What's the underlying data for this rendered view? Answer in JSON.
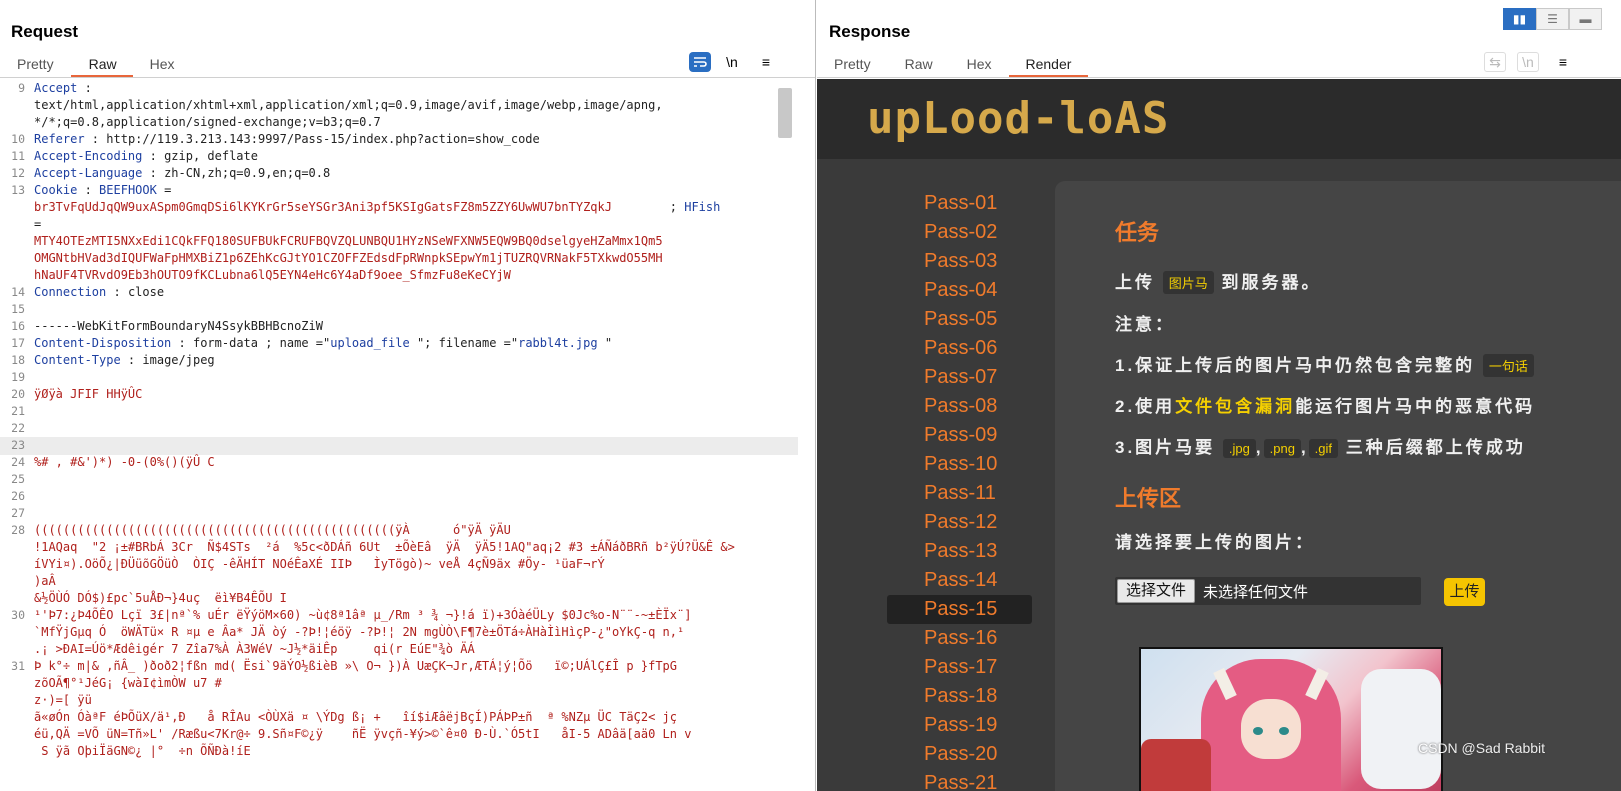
{
  "request": {
    "title": "Request",
    "tabs": [
      "Pretty",
      "Raw",
      "Hex"
    ],
    "active_tab": "Raw",
    "tools": {
      "wrap_icon": "wrap-icon",
      "newline": "\\n",
      "menu_icon": "menu-icon"
    },
    "lines": [
      {
        "n": "9",
        "k": "Accept",
        "sep": " :",
        "v": ""
      },
      {
        "n": "",
        "plain": "text/html,application/xhtml+xml,application/xml;q=0.9,image/avif,image/webp,image/apng,"
      },
      {
        "n": "",
        "plain": "*/*;q=0.8,application/signed-exchange;v=b3;q=0.7"
      },
      {
        "n": "10",
        "k": "Referer",
        "sep": " : ",
        "v": "http://119.3.213.143:9997/Pass-15/index.php?action=show_code"
      },
      {
        "n": "11",
        "k": "Accept-Encoding",
        "sep": " : ",
        "v": "gzip, deflate"
      },
      {
        "n": "12",
        "k": "Accept-Language",
        "sep": " : ",
        "v": "zh-CN,zh;q=0.9,en;q=0.8"
      },
      {
        "n": "13",
        "k": "Cookie",
        "sep": " : ",
        "k2": "BEEFHOOK",
        "v": " ="
      },
      {
        "n": "",
        "red": "br3TvFqUdJqQW9uxASpm0GmqDSi6lKYKrGr5seYSGr3Ani3pf5KSIgGatsFZ8m5ZZY6UwWU7bnTYZqkJ",
        "tail": "        ; ",
        "k3": "HFish"
      },
      {
        "n": "",
        "plain": "="
      },
      {
        "n": "",
        "red": "MTY4OTEzMTI5NXxEdi1CQkFFQ180SUFBUkFCRUFBQVZQLUNBQU1HYzNSeWFXNW5EQW9BQ0dselgyeHZaMmx1Qm5"
      },
      {
        "n": "",
        "red": "OMGNtbHVad3dIQUFWaFpHMXBiZ1p6ZEhKcGJtYO1CZOFFZEdsdFpRWnpkSEpwYm1jTUZRQVRNakF5TXkwdO55MH"
      },
      {
        "n": "",
        "red": "hNaUF4TVRvdO9Eb3hOUTO9fKCLubna6lQ5EYN4eHc6Y4aDf9oee_SfmzFu8eKeCYjW"
      },
      {
        "n": "14",
        "k": "Connection",
        "sep": " : ",
        "v": "close"
      },
      {
        "n": "15",
        "plain": ""
      },
      {
        "n": "16",
        "plain": "------WebKitFormBoundaryN4SsykBBHBcnoZiW"
      },
      {
        "n": "17",
        "k": "Content-Disposition",
        "sep": " : ",
        "v": "form-data ; name =\"",
        "s1": "upload_file",
        "v2": " \"; filename =\"",
        "s2": "rabbl4t.jpg",
        "v3": " \""
      },
      {
        "n": "18",
        "k": "Content-Type",
        "sep": " : ",
        "v": "image/jpeg"
      },
      {
        "n": "19",
        "plain": ""
      },
      {
        "n": "20",
        "red": "ÿØÿà JFIF HHÿÛC"
      },
      {
        "n": "21",
        "plain": ""
      },
      {
        "n": "22",
        "plain": ""
      },
      {
        "n": "23",
        "plain": "",
        "hl": true
      },
      {
        "n": "24",
        "red": "%# , #&')*) -0-(0%()(ÿÛ C"
      },
      {
        "n": "25",
        "plain": ""
      },
      {
        "n": "26",
        "plain": ""
      },
      {
        "n": "27",
        "plain": ""
      },
      {
        "n": "28",
        "red": "((((((((((((((((((((((((((((((((((((((((((((((((((ÿÀ      ó\"ÿÄ ÿÄU"
      },
      {
        "n": "",
        "red": "!1AQaq  \"2 ¡±#BRbÁ 3Cr  Ñ$4STs  ²á  %5c<ðDÁñ 6Ut  ±ÕèEâ  ÿÄ  ÿÄ5!1AQ\"aq¡2 #3 ±ÁÑáðBRñ b²ÿÚ?Ü&Ê &>"
      },
      {
        "n": "",
        "red": "íVYi¤).OöÕ¿|ÐÜüõGÖüÒ  ÒIÇ -êÄHÍT NOéÊaXÉ IIÞ   ÌyTögò)~ veÅ 4çÑ9äx #Öy- ¹üaF¬rÝ"
      },
      {
        "n": "",
        "red": ")aÂ"
      },
      {
        "n": "",
        "red": "&½ÖÙÓ DÓ$)£pc`5uÅÐ¬}4uç  ëì¥B4ÊÕU I"
      },
      {
        "n": "30",
        "red": "¹'Þ7:¿Þ4ÕÊO Lçï 3£|nª`% uÉr ëŸýöM×60) ~ù¢8ª1âª µ_/Rm ³ ¾ ¬}!á ï)+3ÓàéÜLy $0Jc%o-N¨¨-~±ÈÏx¨]"
      },
      {
        "n": "",
        "red": "`MfŸjGµq Ó  öWÄTü× R ¤µ e Âa* JÄ òý -?Þ!¦éöÿ -?Þ!¦ 2N mgÙÒ\\F¶7è±ÖTá÷ÀHàÌìHìçP-¿\"oYkÇ-q n,¹"
      },
      {
        "n": "",
        "red": ".¡ >ÐAI=Úö*Ædêigér 7 Zîa7%À À3WéV ~J½*äiÊp     qi(r EúE\"¾ò ÄÁ"
      },
      {
        "n": "31",
        "red": "Þ k°÷ m|& ,ñÂ_ )ðoð2¦fßn md( Ësi`9äÝO½ßièB »\\ O¬ })À UæÇK¬Jr,ÆTÁ¦ý¦Õö   ï©;UÁlÇ£Î p }fTpG"
      },
      {
        "n": "",
        "red": "zõOÃ¶°¹JéG¡ {wàI¢ìmÒW u7 #"
      },
      {
        "n": "",
        "red": "z·)=[ ÿü"
      },
      {
        "n": "",
        "red": "ã«øÓn ÓàªF éÞÕüX/ä¹,Ð   å RÎAu <ÒÙXä ¤ \\ÝDg ß¡ +   îí$iÆâëjBçÍ)PÁÞP±ñ  ª %NZµ ÜC TäÇ2< jç"
      },
      {
        "n": "",
        "red": "éü,QÄ =VÕ üN=Tñ»L' /Ræßu<7Kr@÷ 9.Sñ¤F©¿ÿ    ñË ÿvçñ-¥ý>©`ê¤0 Ð-Ù.`Ó5tI   åI-5 ADâä[aä0 Ln v"
      },
      {
        "n": "",
        "red": " S ÿã OþiÏäGN©¿ |°  ÷n ÕÑÐà!íE"
      }
    ]
  },
  "response": {
    "title": "Response",
    "tabs": [
      "Pretty",
      "Raw",
      "Hex",
      "Render"
    ],
    "active_tab": "Render",
    "view_icons": [
      "split-horizontal-icon",
      "split-vertical-icon",
      "single-pane-icon"
    ],
    "site": {
      "logo": "upLood-loAS",
      "passes": [
        "Pass-01",
        "Pass-02",
        "Pass-03",
        "Pass-04",
        "Pass-05",
        "Pass-06",
        "Pass-07",
        "Pass-08",
        "Pass-09",
        "Pass-10",
        "Pass-11",
        "Pass-12",
        "Pass-13",
        "Pass-14",
        "Pass-15",
        "Pass-16",
        "Pass-17",
        "Pass-18",
        "Pass-19",
        "Pass-20",
        "Pass-21"
      ],
      "active_pass": "Pass-15",
      "task_heading": "任务",
      "task_line_prefix": "上传",
      "task_chip": "图片马",
      "task_line_suffix": "到服务器。",
      "note_heading": "注意：",
      "note1_prefix": "1.保证上传后的图片马中仍然包含完整的",
      "note1_chip": "一句话",
      "note2_prefix": "2.使用",
      "note2_highlight": "文件包含漏洞",
      "note2_suffix": "能运行图片马中的恶意代码",
      "note3_prefix": "3.图片马要",
      "note3_chip1": ".jpg",
      "note3_chip2": ".png",
      "note3_chip3": ".gif",
      "note3_suffix": "三种后缀都上传成功",
      "upload_heading": "上传区",
      "choose_prompt": "请选择要上传的图片：",
      "file_button": "选择文件",
      "file_none": "未选择任何文件",
      "upload_button": "上传"
    }
  },
  "watermark": "CSDN @Sad Rabbit"
}
